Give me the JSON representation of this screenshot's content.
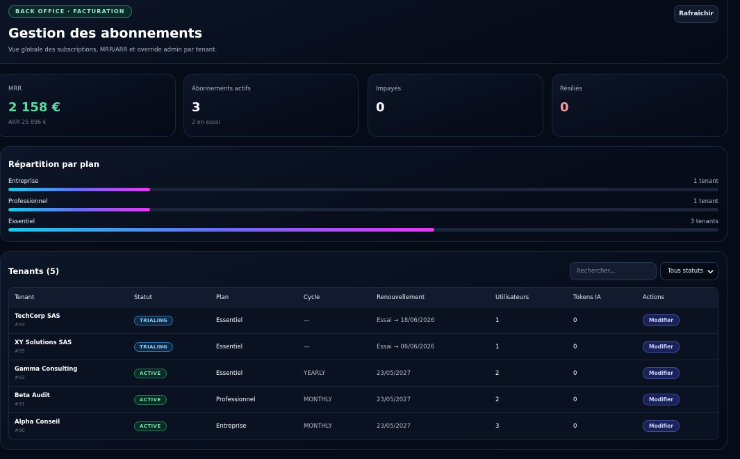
{
  "header": {
    "badge": "BACK OFFICE · FACTURATION",
    "title": "Gestion des abonnements",
    "subtitle": "Vue globale des subscriptions, MRR/ARR et override admin par tenant.",
    "refresh_label": "Rafraîchir"
  },
  "kpis": [
    {
      "label": "MRR",
      "value": "2 158 €",
      "sub": "ARR 25 896 €",
      "color": "#5fd9a4"
    },
    {
      "label": "Abonnements actifs",
      "value": "3",
      "sub": "2 en essai",
      "color": "#ffffff"
    },
    {
      "label": "Impayés",
      "value": "0",
      "sub": "",
      "color": "#ffffff"
    },
    {
      "label": "Résiliés",
      "value": "0",
      "sub": "",
      "color": "#f59ca4"
    }
  ],
  "plans": {
    "title": "Répartition par plan",
    "items": [
      {
        "name": "Entreprise",
        "count": "1 tenant",
        "share": 0.2
      },
      {
        "name": "Professionnel",
        "count": "1 tenant",
        "share": 0.2
      },
      {
        "name": "Essentiel",
        "count": "3 tenants",
        "share": 0.6
      }
    ]
  },
  "tenants": {
    "title": "Tenants (5)",
    "search_placeholder": "Rechercher...",
    "status_filter": "Tous statuts",
    "columns": [
      "Tenant",
      "Statut",
      "Plan",
      "Cycle",
      "Renouvellement",
      "Utilisateurs",
      "Tokens IA",
      "Actions"
    ],
    "modify_label": "Modifier",
    "rows": [
      {
        "name": "TechCorp SAS",
        "id": "#93",
        "status": "TRIALING",
        "plan": "Essentiel",
        "cycle": "—",
        "renewal": "Essai → 18/06/2026",
        "users": "1",
        "tokens": "0"
      },
      {
        "name": "XY Solutions SAS",
        "id": "#95",
        "status": "TRIALING",
        "plan": "Essentiel",
        "cycle": "—",
        "renewal": "Essai → 06/06/2026",
        "users": "1",
        "tokens": "0"
      },
      {
        "name": "Gamma Consulting",
        "id": "#92",
        "status": "ACTIVE",
        "plan": "Essentiel",
        "cycle": "YEARLY",
        "renewal": "23/05/2027",
        "users": "2",
        "tokens": "0"
      },
      {
        "name": "Beta Audit",
        "id": "#91",
        "status": "ACTIVE",
        "plan": "Professionnel",
        "cycle": "MONTHLY",
        "renewal": "23/05/2027",
        "users": "2",
        "tokens": "0"
      },
      {
        "name": "Alpha Conseil",
        "id": "#90",
        "status": "ACTIVE",
        "plan": "Entreprise",
        "cycle": "MONTHLY",
        "renewal": "23/05/2027",
        "users": "3",
        "tokens": "0"
      }
    ]
  }
}
